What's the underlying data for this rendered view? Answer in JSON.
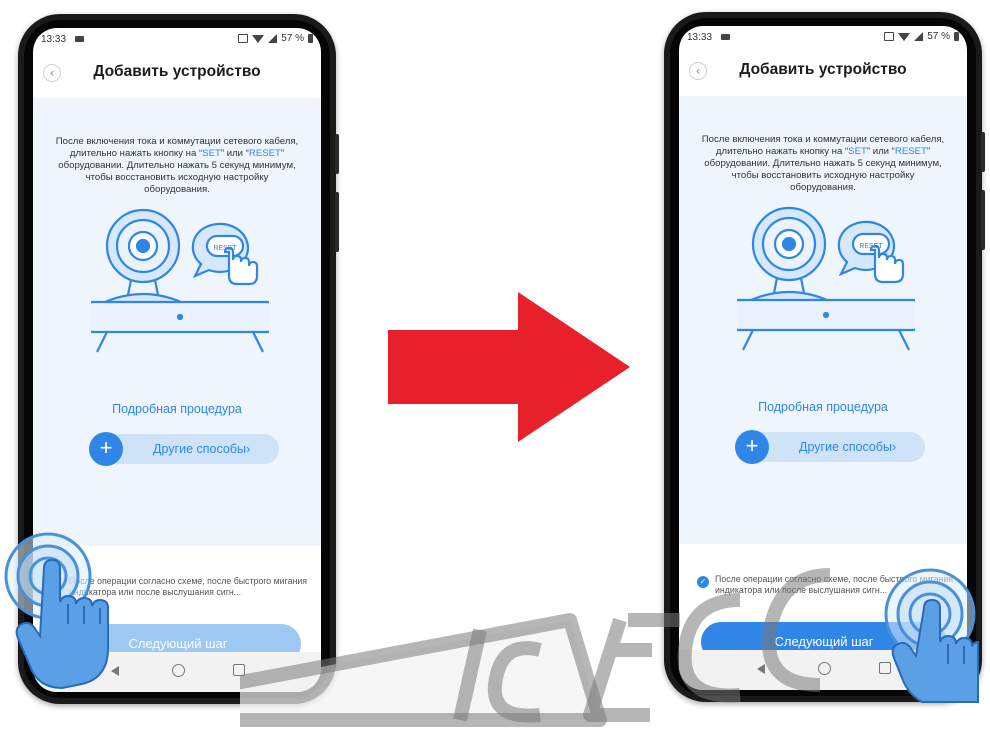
{
  "left_phone": {
    "status": {
      "time": "13:33",
      "battery": "57 %"
    },
    "header": {
      "title": "Добавить устройство",
      "back_icon": "chevron-left-icon"
    },
    "instructions": {
      "part1": "После включения тока и коммутации сетевого кабеля, длительно нажать кнопку на “",
      "set": "SET",
      "part2": "” или “",
      "reset": "RESET",
      "part3": "” оборудовании. Длительно нажать 5 секунд минимум, чтобы восстановить исходную настройку оборудования."
    },
    "illustration": {
      "reset_label": "RESET"
    },
    "detailed_link": "Подробная процедура",
    "other_methods": {
      "plus": "+",
      "label": "Другие способы",
      "chevron": "›"
    },
    "agreement": {
      "checked": false,
      "text": "После операции согласно схеме, после быстрого мигания индикатора или после выслушания сигн..."
    },
    "next_button": {
      "label": "Следующий шаг",
      "enabled": false
    }
  },
  "right_phone": {
    "status": {
      "time": "13:33",
      "battery": "57 %"
    },
    "header": {
      "title": "Добавить устройство",
      "back_icon": "chevron-left-icon"
    },
    "instructions": {
      "part1": "После включения тока и коммутации сетевого кабеля, длительно нажать кнопку на “",
      "set": "SET",
      "part2": "” или “",
      "reset": "RESET",
      "part3": "” оборудовании. Длительно нажать 5 секунд минимум, чтобы восстановить исходную настройку оборудования."
    },
    "illustration": {
      "reset_label": "RESET"
    },
    "detailed_link": "Подробная процедура",
    "other_methods": {
      "plus": "+",
      "label": "Другие способы",
      "chevron": "›"
    },
    "agreement": {
      "checked": true,
      "text": "После операции согласно схеме, после быстрого мигания индикатора или после выслушания сигн..."
    },
    "next_button": {
      "label": "Следующий шаг",
      "enabled": true
    }
  },
  "colors": {
    "accent": "#2f86e6",
    "arrow": "#e8202a",
    "pill": "#cfe3f8",
    "content_bg": "#eef5fd"
  },
  "icons": {
    "arrow": "right-arrow-icon",
    "tap": "tap-hand-icon",
    "watermark": "watermark-logo"
  }
}
